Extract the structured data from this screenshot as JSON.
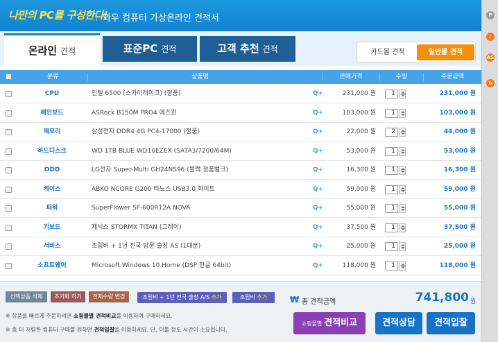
{
  "header": {
    "slogan": "나만의 PC를 구성한다!",
    "title": "와우 컴퓨터 가상온라인 견적서"
  },
  "tabs": [
    {
      "main": "온라인",
      "sub": "견적",
      "active": true
    },
    {
      "main": "표준PC",
      "sub": "견적",
      "active": false
    },
    {
      "main": "고객 추천",
      "sub": "견적",
      "active": false
    }
  ],
  "estimate_type": {
    "card": "카드몰 견적",
    "general": "일반몰 견적"
  },
  "table": {
    "columns": [
      "분류",
      "상품명",
      "판매가격",
      "수량",
      "주문금액"
    ],
    "rows": [
      {
        "category": "CPU",
        "name": "인텔 6500 (스카이레이크) (정품)",
        "zoom": "Q+",
        "price": "231,000 원",
        "qty": "1",
        "total": "231,000 원"
      },
      {
        "category": "메인보드",
        "name": "ASRock B150M PRO4 에즈윈",
        "zoom": "Q+",
        "price": "103,000 원",
        "qty": "1",
        "total": "103,000 원"
      },
      {
        "category": "메모리",
        "name": "삼성전자 DDR4 4G PC4-17000 (정품)",
        "zoom": "Q+",
        "price": "22,000 원",
        "qty": "2",
        "total": "44,000 원"
      },
      {
        "category": "하드디스크",
        "name": "WD 1TB BLUE WD10EZEX (SATA3/7200/64M)",
        "zoom": "Q+",
        "price": "53,000 원",
        "qty": "1",
        "total": "53,000 원"
      },
      {
        "category": "ODD",
        "name": "LG전자 Super-Multi GH24NS96 (블랙 정품벌크)",
        "zoom": "Q+",
        "price": "16,300 원",
        "qty": "1",
        "total": "16,300 원"
      },
      {
        "category": "케이스",
        "name": "ABKO NCORE G200 타노스 USB3.0 화이트",
        "zoom": "Q+",
        "price": "59,000 원",
        "qty": "1",
        "total": "59,000 원"
      },
      {
        "category": "파워",
        "name": "SuperFlower SF-600R12A NOVA",
        "zoom": "Q+",
        "price": "55,000 원",
        "qty": "1",
        "total": "55,000 원"
      },
      {
        "category": "키보드",
        "name": "제닉스 STORMX TITAN (그레이)",
        "zoom": "Q+",
        "price": "37,500 원",
        "qty": "1",
        "total": "37,500 원"
      },
      {
        "category": "서비스",
        "name": "조립비 + 1년 전국 방문 출장 AS (1대분)",
        "zoom": "Q+",
        "price": "25,000 원",
        "qty": "1",
        "total": "25,000 원"
      },
      {
        "category": "소프트웨어",
        "name": "Microsoft Windows 10 Home (DSP 한글 64bit)",
        "zoom": "Q+",
        "price": "118,000 원",
        "qty": "1",
        "total": "118,000 원"
      }
    ]
  },
  "actions": {
    "delete_selected": "선택상품 삭제",
    "reset": "초기화 하기",
    "change_qty": "전체수량 변경",
    "add_as_prefix": "조립비 + 1년 전국 출장 A/S",
    "add_as_suffix": "추가",
    "add_assembly_prefix": "조립비",
    "add_assembly_suffix": "추가"
  },
  "notes": {
    "line1_pre": "※ 상품을 빠르게 주문하려면",
    "line1_bold": "쇼핑몰별 견적비교",
    "line1_post": "를 이용하여 구매하세요.",
    "line2_pre": "※ 좀 더 저렴한 컴퓨터 구매를 원하면",
    "line2_bold": "견적입찰",
    "line2_post": "을 이용하세요. 단, 이틀 정도 시간이 소요됩니다."
  },
  "summary": {
    "currency_symbol": "₩",
    "label": "총 견적금액",
    "value": "741,800",
    "unit": "원"
  },
  "buttons": {
    "compare_small": "쇼핑몰별",
    "compare_main": "견적비교",
    "consult": "견적상담",
    "bid": "견적입찰"
  },
  "rail": {
    "icon1": "P",
    "icon2": "♪",
    "icon3": "AS",
    "icon4": "↻"
  }
}
